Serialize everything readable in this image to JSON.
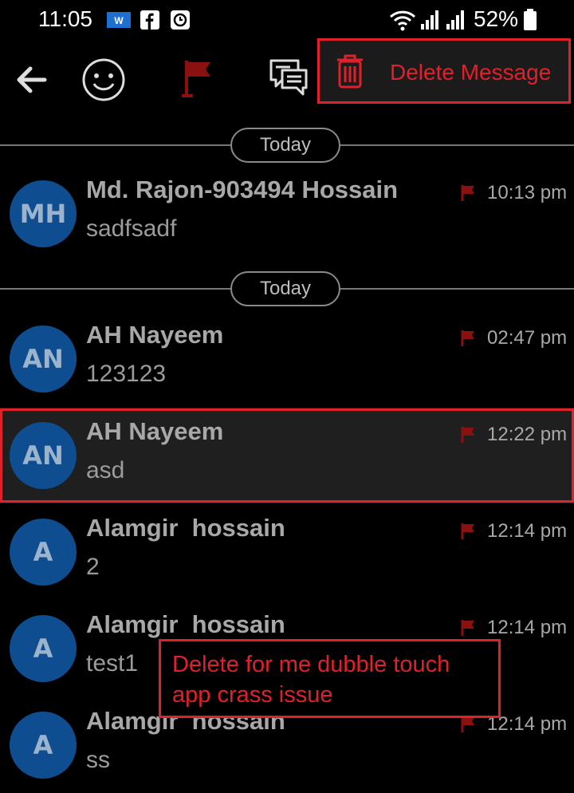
{
  "status_bar": {
    "time": "11:05",
    "battery": "52%",
    "icons": [
      "wps-icon",
      "facebook-icon",
      "clock-icon",
      "wifi-icon",
      "signal-icon",
      "signal-icon",
      "battery-icon"
    ]
  },
  "toolbar": {
    "icons": [
      "back-arrow-icon",
      "emoji-icon",
      "flag-icon",
      "chat-icon"
    ]
  },
  "delete_menu": {
    "label": "Delete Message",
    "icon": "trash-icon",
    "color": "#e0202a"
  },
  "sections": [
    {
      "date_label": "Today"
    },
    {
      "date_label": "Today"
    }
  ],
  "messages": [
    {
      "initials": "MH",
      "name": "Md. Rajon-903494 Hossain",
      "text": "sadfsadf",
      "time": "10:13 pm"
    },
    {
      "initials": "AN",
      "name": "AH Nayeem",
      "text": "123123",
      "time": "02:47 pm"
    },
    {
      "initials": "AN",
      "name": "AH Nayeem",
      "text": "asd",
      "time": "12:22 pm",
      "selected": true
    },
    {
      "initials": "A",
      "name": "Alamgir  hossain",
      "text": "2",
      "time": "12:14 pm"
    },
    {
      "initials": "A",
      "name": "Alamgir  hossain",
      "text": "test1",
      "time": "12:14 pm"
    },
    {
      "initials": "A",
      "name": "Alamgir  hossain",
      "text": "ss",
      "time": "12:14 pm"
    }
  ],
  "annotation": {
    "line1": "Delete for me dubble touch",
    "line2": "app crass issue"
  },
  "colors": {
    "background": "#000000",
    "avatar": "#0e4d8f",
    "flag": "#8b1010",
    "annotation": "#e0202a"
  }
}
